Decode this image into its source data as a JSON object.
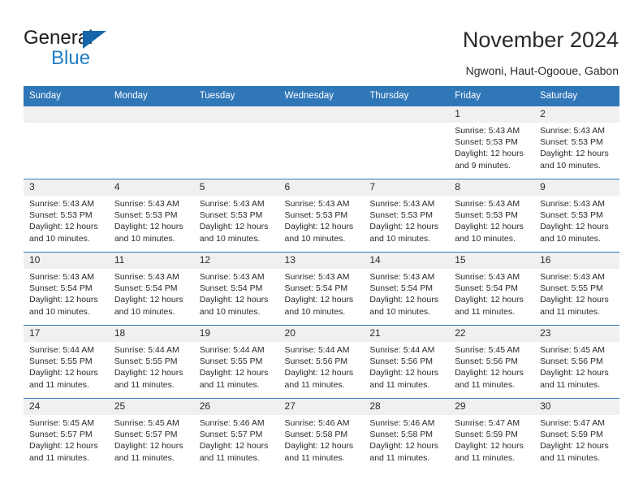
{
  "brand": {
    "name_part1": "General",
    "name_part2": "Blue",
    "accent_color": "#1f7ec4",
    "triangle_color": "#1565a8"
  },
  "header": {
    "title": "November 2024",
    "location": "Ngwoni, Haut-Ogooue, Gabon",
    "header_bg_color": "#3077b8",
    "daynum_bg_color": "#f0f0f0"
  },
  "weekday_headers": [
    "Sunday",
    "Monday",
    "Tuesday",
    "Wednesday",
    "Thursday",
    "Friday",
    "Saturday"
  ],
  "labels": {
    "sunrise_prefix": "Sunrise:",
    "sunset_prefix": "Sunset:",
    "daylight_prefix": "Daylight:"
  },
  "weeks": [
    [
      {
        "day": "",
        "blank": true,
        "sunrise": "",
        "sunset": "",
        "daylight": ""
      },
      {
        "day": "",
        "blank": true,
        "sunrise": "",
        "sunset": "",
        "daylight": ""
      },
      {
        "day": "",
        "blank": true,
        "sunrise": "",
        "sunset": "",
        "daylight": ""
      },
      {
        "day": "",
        "blank": true,
        "sunrise": "",
        "sunset": "",
        "daylight": ""
      },
      {
        "day": "",
        "blank": true,
        "sunrise": "",
        "sunset": "",
        "daylight": ""
      },
      {
        "day": "1",
        "blank": false,
        "sunrise": "Sunrise: 5:43 AM",
        "sunset": "Sunset: 5:53 PM",
        "daylight": "Daylight: 12 hours and 9 minutes."
      },
      {
        "day": "2",
        "blank": false,
        "sunrise": "Sunrise: 5:43 AM",
        "sunset": "Sunset: 5:53 PM",
        "daylight": "Daylight: 12 hours and 10 minutes."
      }
    ],
    [
      {
        "day": "3",
        "blank": false,
        "sunrise": "Sunrise: 5:43 AM",
        "sunset": "Sunset: 5:53 PM",
        "daylight": "Daylight: 12 hours and 10 minutes."
      },
      {
        "day": "4",
        "blank": false,
        "sunrise": "Sunrise: 5:43 AM",
        "sunset": "Sunset: 5:53 PM",
        "daylight": "Daylight: 12 hours and 10 minutes."
      },
      {
        "day": "5",
        "blank": false,
        "sunrise": "Sunrise: 5:43 AM",
        "sunset": "Sunset: 5:53 PM",
        "daylight": "Daylight: 12 hours and 10 minutes."
      },
      {
        "day": "6",
        "blank": false,
        "sunrise": "Sunrise: 5:43 AM",
        "sunset": "Sunset: 5:53 PM",
        "daylight": "Daylight: 12 hours and 10 minutes."
      },
      {
        "day": "7",
        "blank": false,
        "sunrise": "Sunrise: 5:43 AM",
        "sunset": "Sunset: 5:53 PM",
        "daylight": "Daylight: 12 hours and 10 minutes."
      },
      {
        "day": "8",
        "blank": false,
        "sunrise": "Sunrise: 5:43 AM",
        "sunset": "Sunset: 5:53 PM",
        "daylight": "Daylight: 12 hours and 10 minutes."
      },
      {
        "day": "9",
        "blank": false,
        "sunrise": "Sunrise: 5:43 AM",
        "sunset": "Sunset: 5:53 PM",
        "daylight": "Daylight: 12 hours and 10 minutes."
      }
    ],
    [
      {
        "day": "10",
        "blank": false,
        "sunrise": "Sunrise: 5:43 AM",
        "sunset": "Sunset: 5:54 PM",
        "daylight": "Daylight: 12 hours and 10 minutes."
      },
      {
        "day": "11",
        "blank": false,
        "sunrise": "Sunrise: 5:43 AM",
        "sunset": "Sunset: 5:54 PM",
        "daylight": "Daylight: 12 hours and 10 minutes."
      },
      {
        "day": "12",
        "blank": false,
        "sunrise": "Sunrise: 5:43 AM",
        "sunset": "Sunset: 5:54 PM",
        "daylight": "Daylight: 12 hours and 10 minutes."
      },
      {
        "day": "13",
        "blank": false,
        "sunrise": "Sunrise: 5:43 AM",
        "sunset": "Sunset: 5:54 PM",
        "daylight": "Daylight: 12 hours and 10 minutes."
      },
      {
        "day": "14",
        "blank": false,
        "sunrise": "Sunrise: 5:43 AM",
        "sunset": "Sunset: 5:54 PM",
        "daylight": "Daylight: 12 hours and 10 minutes."
      },
      {
        "day": "15",
        "blank": false,
        "sunrise": "Sunrise: 5:43 AM",
        "sunset": "Sunset: 5:54 PM",
        "daylight": "Daylight: 12 hours and 11 minutes."
      },
      {
        "day": "16",
        "blank": false,
        "sunrise": "Sunrise: 5:43 AM",
        "sunset": "Sunset: 5:55 PM",
        "daylight": "Daylight: 12 hours and 11 minutes."
      }
    ],
    [
      {
        "day": "17",
        "blank": false,
        "sunrise": "Sunrise: 5:44 AM",
        "sunset": "Sunset: 5:55 PM",
        "daylight": "Daylight: 12 hours and 11 minutes."
      },
      {
        "day": "18",
        "blank": false,
        "sunrise": "Sunrise: 5:44 AM",
        "sunset": "Sunset: 5:55 PM",
        "daylight": "Daylight: 12 hours and 11 minutes."
      },
      {
        "day": "19",
        "blank": false,
        "sunrise": "Sunrise: 5:44 AM",
        "sunset": "Sunset: 5:55 PM",
        "daylight": "Daylight: 12 hours and 11 minutes."
      },
      {
        "day": "20",
        "blank": false,
        "sunrise": "Sunrise: 5:44 AM",
        "sunset": "Sunset: 5:56 PM",
        "daylight": "Daylight: 12 hours and 11 minutes."
      },
      {
        "day": "21",
        "blank": false,
        "sunrise": "Sunrise: 5:44 AM",
        "sunset": "Sunset: 5:56 PM",
        "daylight": "Daylight: 12 hours and 11 minutes."
      },
      {
        "day": "22",
        "blank": false,
        "sunrise": "Sunrise: 5:45 AM",
        "sunset": "Sunset: 5:56 PM",
        "daylight": "Daylight: 12 hours and 11 minutes."
      },
      {
        "day": "23",
        "blank": false,
        "sunrise": "Sunrise: 5:45 AM",
        "sunset": "Sunset: 5:56 PM",
        "daylight": "Daylight: 12 hours and 11 minutes."
      }
    ],
    [
      {
        "day": "24",
        "blank": false,
        "sunrise": "Sunrise: 5:45 AM",
        "sunset": "Sunset: 5:57 PM",
        "daylight": "Daylight: 12 hours and 11 minutes."
      },
      {
        "day": "25",
        "blank": false,
        "sunrise": "Sunrise: 5:45 AM",
        "sunset": "Sunset: 5:57 PM",
        "daylight": "Daylight: 12 hours and 11 minutes."
      },
      {
        "day": "26",
        "blank": false,
        "sunrise": "Sunrise: 5:46 AM",
        "sunset": "Sunset: 5:57 PM",
        "daylight": "Daylight: 12 hours and 11 minutes."
      },
      {
        "day": "27",
        "blank": false,
        "sunrise": "Sunrise: 5:46 AM",
        "sunset": "Sunset: 5:58 PM",
        "daylight": "Daylight: 12 hours and 11 minutes."
      },
      {
        "day": "28",
        "blank": false,
        "sunrise": "Sunrise: 5:46 AM",
        "sunset": "Sunset: 5:58 PM",
        "daylight": "Daylight: 12 hours and 11 minutes."
      },
      {
        "day": "29",
        "blank": false,
        "sunrise": "Sunrise: 5:47 AM",
        "sunset": "Sunset: 5:59 PM",
        "daylight": "Daylight: 12 hours and 11 minutes."
      },
      {
        "day": "30",
        "blank": false,
        "sunrise": "Sunrise: 5:47 AM",
        "sunset": "Sunset: 5:59 PM",
        "daylight": "Daylight: 12 hours and 11 minutes."
      }
    ]
  ]
}
